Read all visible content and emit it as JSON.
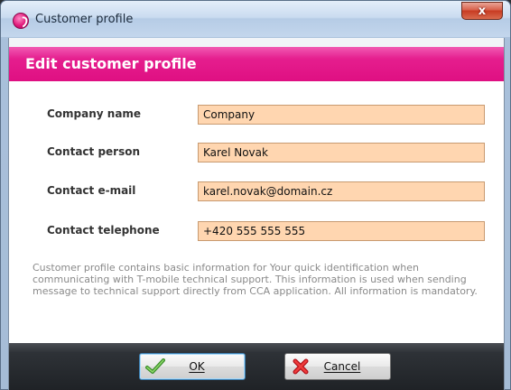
{
  "window": {
    "title": "Customer profile",
    "close_glyph": "x"
  },
  "header": {
    "title": "Edit customer profile"
  },
  "form": {
    "fields": [
      {
        "label": "Company name",
        "value": "Company"
      },
      {
        "label": "Contact person",
        "value": "Karel Novak"
      },
      {
        "label": "Contact e-mail",
        "value": "karel.novak@domain.cz"
      },
      {
        "label": "Contact telephone",
        "value": "+420 555 555 555"
      }
    ]
  },
  "info": {
    "text": "Customer profile contains basic information for Your quick identification when communicating with T-mobile technical support. This information is used when sending message to technical support directly from CCA application. All information is mandatory."
  },
  "buttons": {
    "ok_label": "OK",
    "cancel_label": "Cancel"
  },
  "icons": {
    "app": "t-mobile-app-icon",
    "ok": "checkmark-icon",
    "cancel": "red-x-icon"
  },
  "colors": {
    "accent_magenta": "#e20074",
    "input_fill": "#ffd6b0",
    "button_bar": "#2a2e33"
  }
}
